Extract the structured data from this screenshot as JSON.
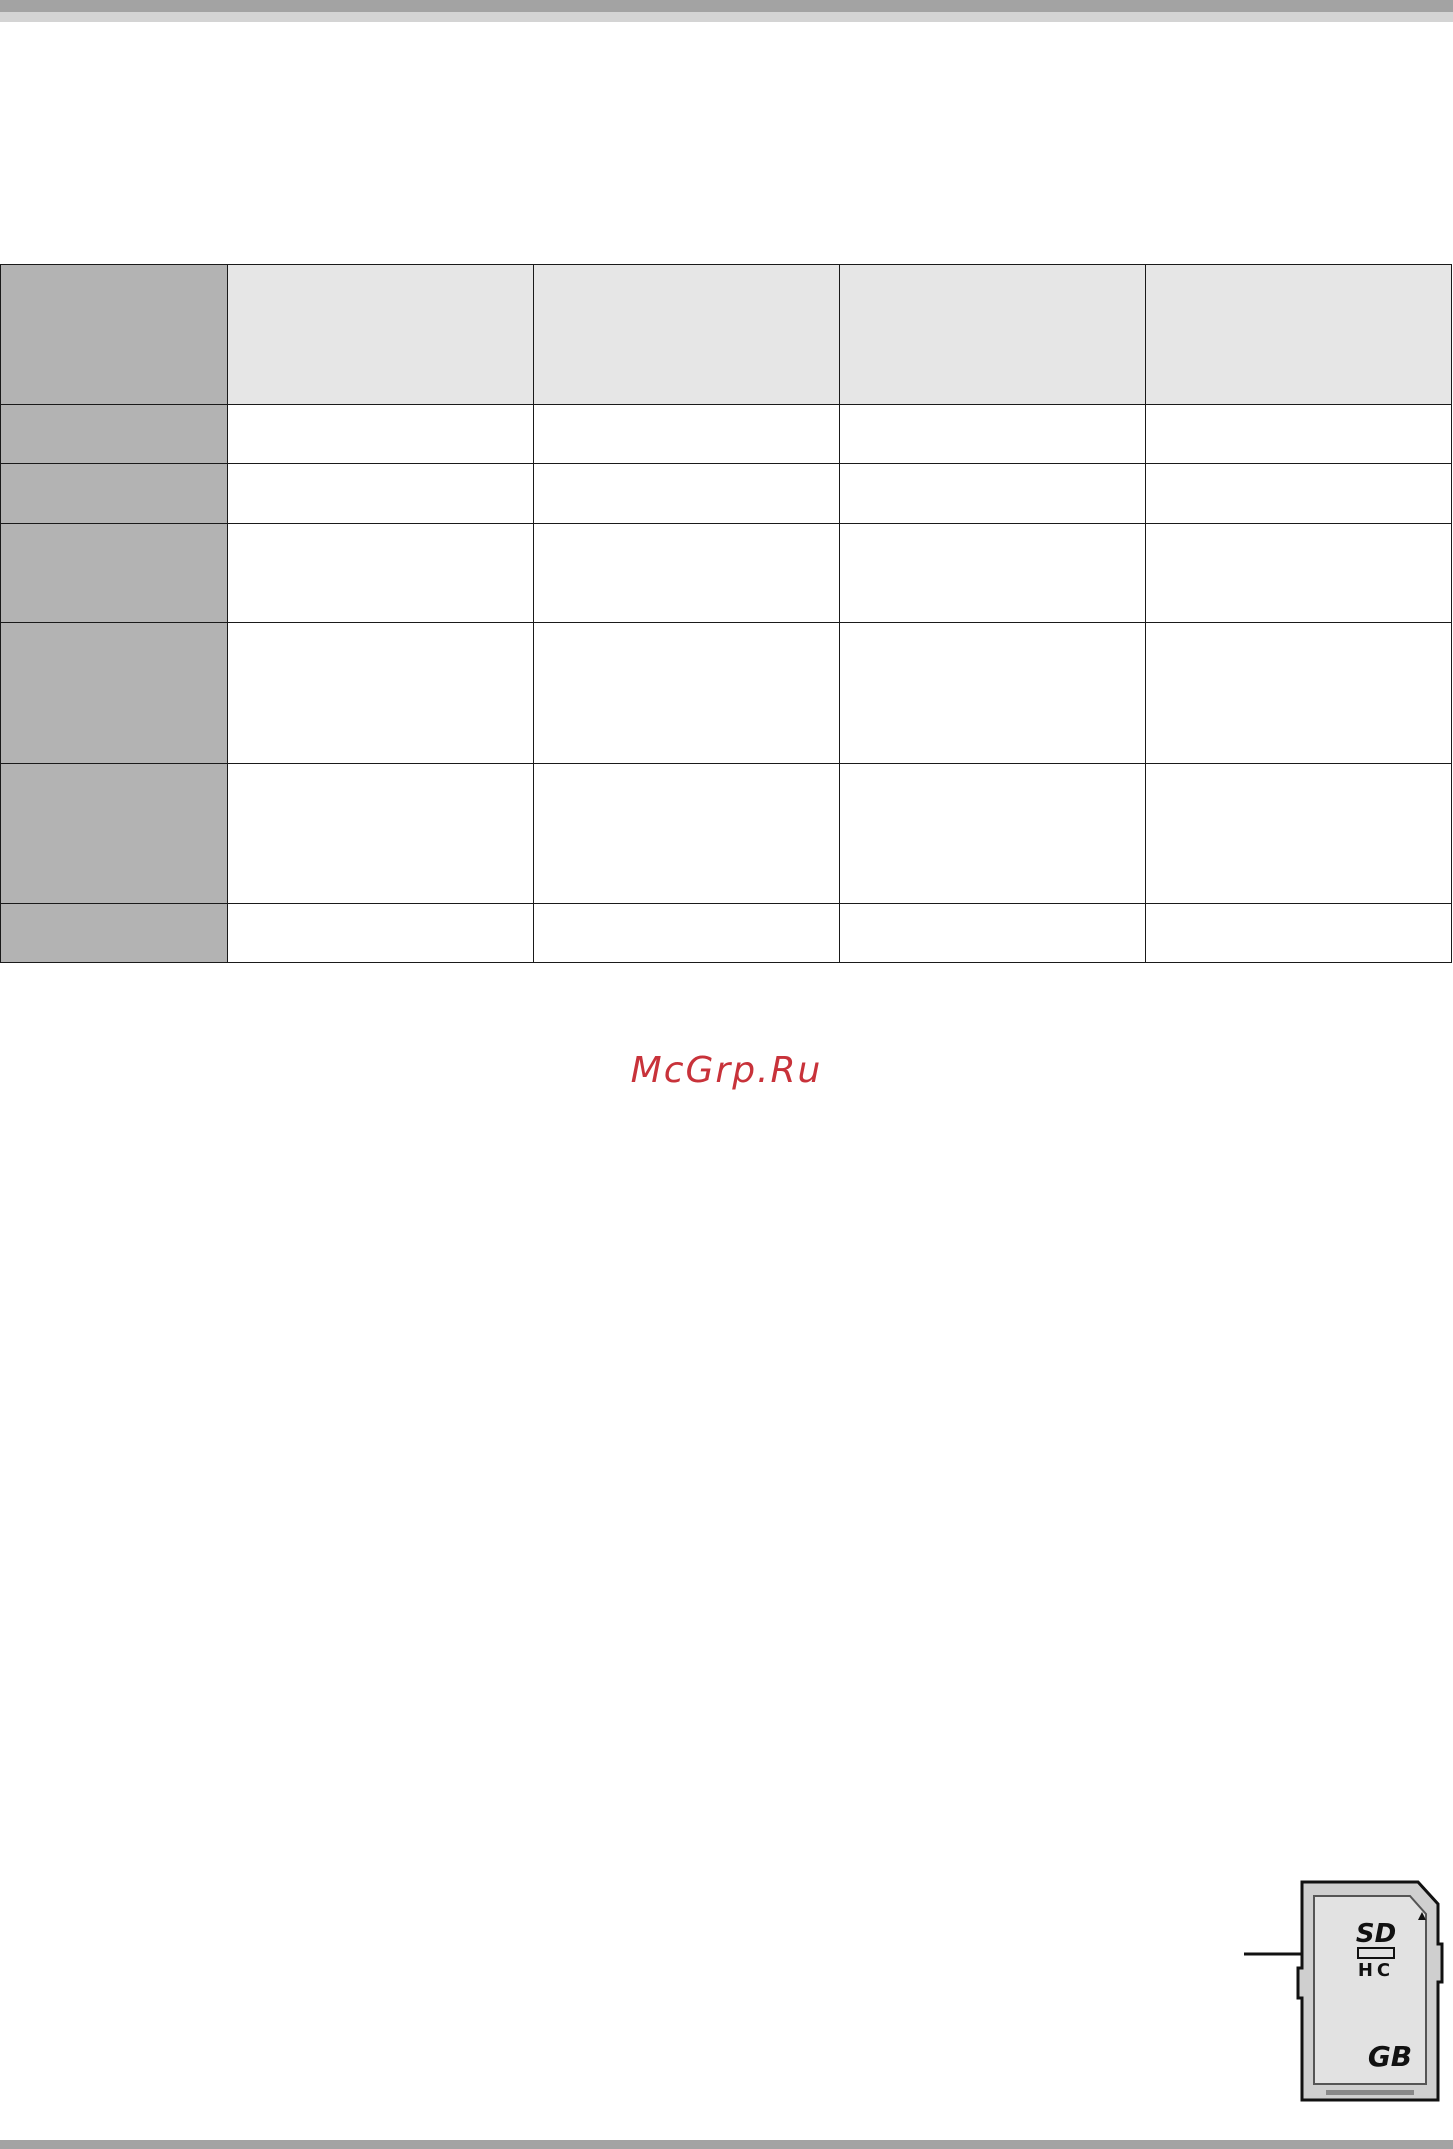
{
  "watermark": {
    "text": "McGrp.Ru"
  },
  "table": {
    "column_count": 5,
    "body_row_count": 6
  },
  "sd_card_icon": {
    "logo_letters_top": "SD",
    "logo_letters_bottom": "HC",
    "capacity_unit": "GB"
  },
  "colors": {
    "header_row_fill": "#e6e6e6",
    "first_column_fill": "#b3b3b3",
    "watermark": "#c8323a",
    "page_bars": "#a3a3a3"
  }
}
